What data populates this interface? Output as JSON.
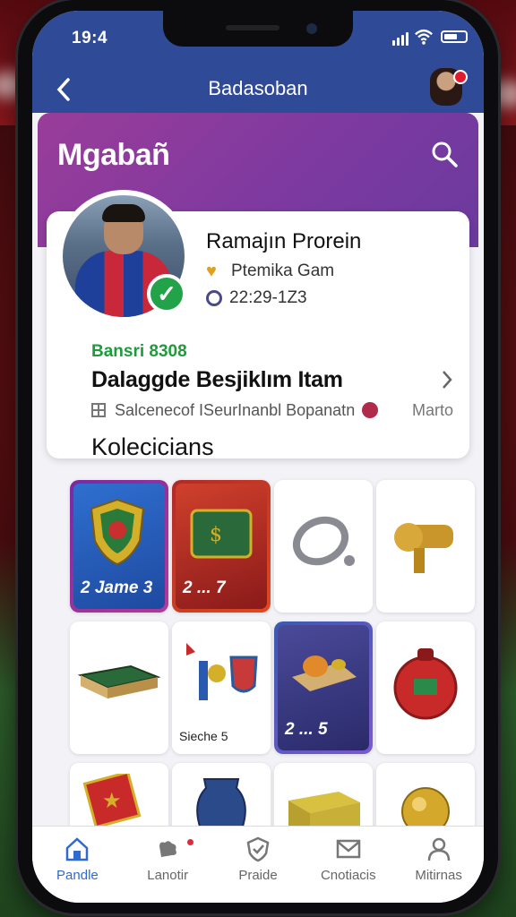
{
  "status": {
    "time": "19:4"
  },
  "nav": {
    "title": "Badasoban"
  },
  "header": {
    "title": "Mgabañ"
  },
  "profile": {
    "name": "Ramajın Prorein",
    "role": "Ptemika Gam",
    "id": "22:29-1Z3",
    "balance": "Bansri 8308",
    "item_title": "Dalaggde Besjiklım Itam",
    "item_sub": "Salcenecof ISeurInanbl Bopanatn",
    "item_more": "Marto",
    "section": "Kolecicians"
  },
  "tiles": [
    {
      "text": "2 Jame 3"
    },
    {
      "text": "2 ... 7"
    },
    {
      "text": ""
    },
    {
      "text": ""
    },
    {
      "text": ""
    },
    {
      "text": "Sieche 5"
    },
    {
      "text": "2 ... 5"
    },
    {
      "text": ""
    },
    {
      "text": ""
    },
    {
      "text": ""
    },
    {
      "text": ""
    },
    {
      "text": ""
    }
  ],
  "tabs": [
    {
      "label": "Pandle"
    },
    {
      "label": "Lanotir"
    },
    {
      "label": "Praide"
    },
    {
      "label": "Cnotiacis"
    },
    {
      "label": "Mitirnas"
    }
  ],
  "colors": {
    "accent": "#2f4a96",
    "header_purple": "#8a3c9c",
    "green": "#1e9b3a",
    "tab_active": "#2f6ad0"
  }
}
